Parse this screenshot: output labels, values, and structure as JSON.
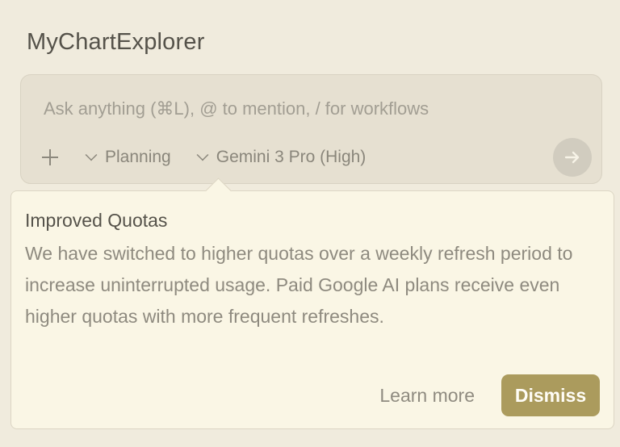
{
  "app": {
    "title": "MyChartExplorer"
  },
  "composer": {
    "placeholder": "Ask anything (⌘L), @ to mention, / for workflows",
    "mode_label": "Planning",
    "model_label": "Gemini 3 Pro (High)",
    "add_icon": "plus-icon",
    "send_icon": "arrow-right-icon"
  },
  "popup": {
    "title": "Improved Quotas",
    "body": "We have switched to higher quotas over a weekly refresh period to increase uninterrupted usage. Paid Google AI plans receive even higher quotas with more frequent refreshes.",
    "learn_more_label": "Learn more",
    "dismiss_label": "Dismiss"
  },
  "colors": {
    "background": "#f0ebdd",
    "composer": "#e6e0d1",
    "popup": "#faf6e5",
    "accent": "#ab9b5d"
  }
}
